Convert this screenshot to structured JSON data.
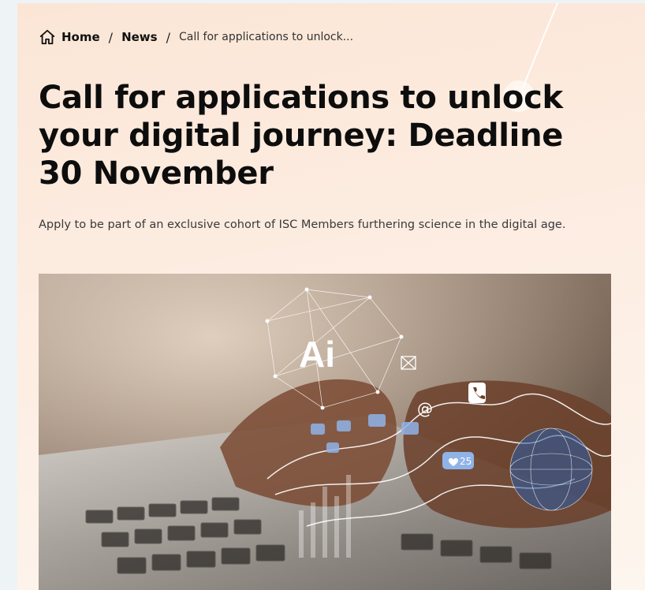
{
  "breadcrumb": {
    "home_label": "Home",
    "separator": "/",
    "news_label": "News",
    "current_label": "Call for applications to unlock..."
  },
  "article": {
    "title": "Call for applications to unlock your digital journey: Deadline 30 November",
    "subtitle": "Apply to be part of an exclusive cohort of ISC Members furthering science in the digital age."
  },
  "hero_image": {
    "ai_label": "Ai",
    "like_count": "25"
  },
  "colors": {
    "background_gradient_start": "#fbe6d6",
    "background_gradient_end": "#fdf6ee",
    "title_text": "#0d0d0d",
    "body_text": "#3a3a3a"
  }
}
